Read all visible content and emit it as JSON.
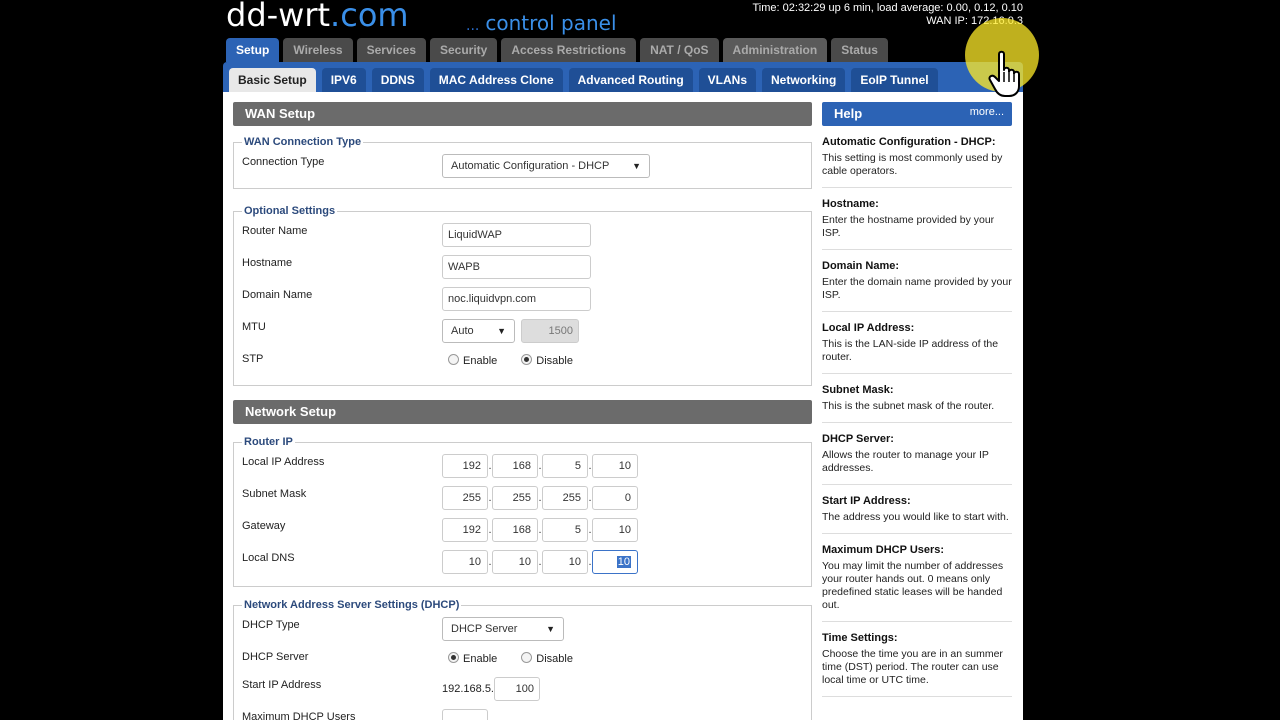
{
  "header": {
    "logo_main": "dd-wrt",
    "logo_dot": ".com",
    "logo_sub_dots": "...",
    "logo_sub": "control panel",
    "time_line": "Time: 02:32:29 up 6 min, load average: 0.00, 0.12, 0.10",
    "wan_ip_line": "WAN IP: 172.16.0.3"
  },
  "main_tabs": [
    {
      "label": "Setup"
    },
    {
      "label": "Wireless"
    },
    {
      "label": "Services"
    },
    {
      "label": "Security"
    },
    {
      "label": "Access Restrictions"
    },
    {
      "label": "NAT / QoS"
    },
    {
      "label": "Administration"
    },
    {
      "label": "Status"
    }
  ],
  "sub_tabs": [
    {
      "label": "Basic Setup"
    },
    {
      "label": "IPV6"
    },
    {
      "label": "DDNS"
    },
    {
      "label": "MAC Address Clone"
    },
    {
      "label": "Advanced Routing"
    },
    {
      "label": "VLANs"
    },
    {
      "label": "Networking"
    },
    {
      "label": "EoIP Tunnel"
    }
  ],
  "wan_setup": {
    "title": "WAN Setup",
    "conn_legend": "WAN Connection Type",
    "conn_label": "Connection Type",
    "conn_value": "Automatic Configuration - DHCP",
    "optional_legend": "Optional Settings",
    "router_name_label": "Router Name",
    "router_name_value": "LiquidWAP",
    "hostname_label": "Hostname",
    "hostname_value": "WAPB",
    "domain_label": "Domain Name",
    "domain_value": "noc.liquidvpn.com",
    "mtu_label": "MTU",
    "mtu_mode": "Auto",
    "mtu_value": "1500",
    "stp_label": "STP",
    "stp_enable": "Enable",
    "stp_disable": "Disable"
  },
  "network_setup": {
    "title": "Network Setup",
    "router_ip_legend": "Router IP",
    "local_ip_label": "Local IP Address",
    "local_ip": [
      "192",
      "168",
      "5",
      "10"
    ],
    "subnet_label": "Subnet Mask",
    "subnet": [
      "255",
      "255",
      "255",
      "0"
    ],
    "gateway_label": "Gateway",
    "gateway": [
      "192",
      "168",
      "5",
      "10"
    ],
    "dns_label": "Local DNS",
    "dns": [
      "10",
      "10",
      "10",
      "10"
    ],
    "dhcp_legend": "Network Address Server Settings (DHCP)",
    "dhcp_type_label": "DHCP Type",
    "dhcp_type_value": "DHCP Server",
    "dhcp_server_label": "DHCP Server",
    "dhcp_enable": "Enable",
    "dhcp_disable": "Disable",
    "start_ip_label": "Start IP Address",
    "start_ip_prefix": "192.168.5.",
    "start_ip_value": "100",
    "max_users_label": "Maximum DHCP Users"
  },
  "help": {
    "title": "Help",
    "more": "more...",
    "items": [
      {
        "title": "Automatic Configuration - DHCP:",
        "desc": "This setting is most commonly used by cable operators."
      },
      {
        "title": "Hostname:",
        "desc": "Enter the hostname provided by your ISP."
      },
      {
        "title": "Domain Name:",
        "desc": "Enter the domain name provided by your ISP."
      },
      {
        "title": "Local IP Address:",
        "desc": "This is the LAN-side IP address of the router."
      },
      {
        "title": "Subnet Mask:",
        "desc": "This is the subnet mask of the router."
      },
      {
        "title": "DHCP Server:",
        "desc": "Allows the router to manage your IP addresses."
      },
      {
        "title": "Start IP Address:",
        "desc": "The address you would like to start with."
      },
      {
        "title": "Maximum DHCP Users:",
        "desc": "You may limit the number of addresses your router hands out. 0 means only predefined static leases will be handed out."
      },
      {
        "title": "Time Settings:",
        "desc": "Choose the time you are in an summer time (DST) period. The router can use local time or UTC time."
      }
    ]
  },
  "colors": {
    "accent_blue": "#2c63b5",
    "section_gray": "#6b6b6b",
    "cursor_highlight": "#ffeb28"
  }
}
